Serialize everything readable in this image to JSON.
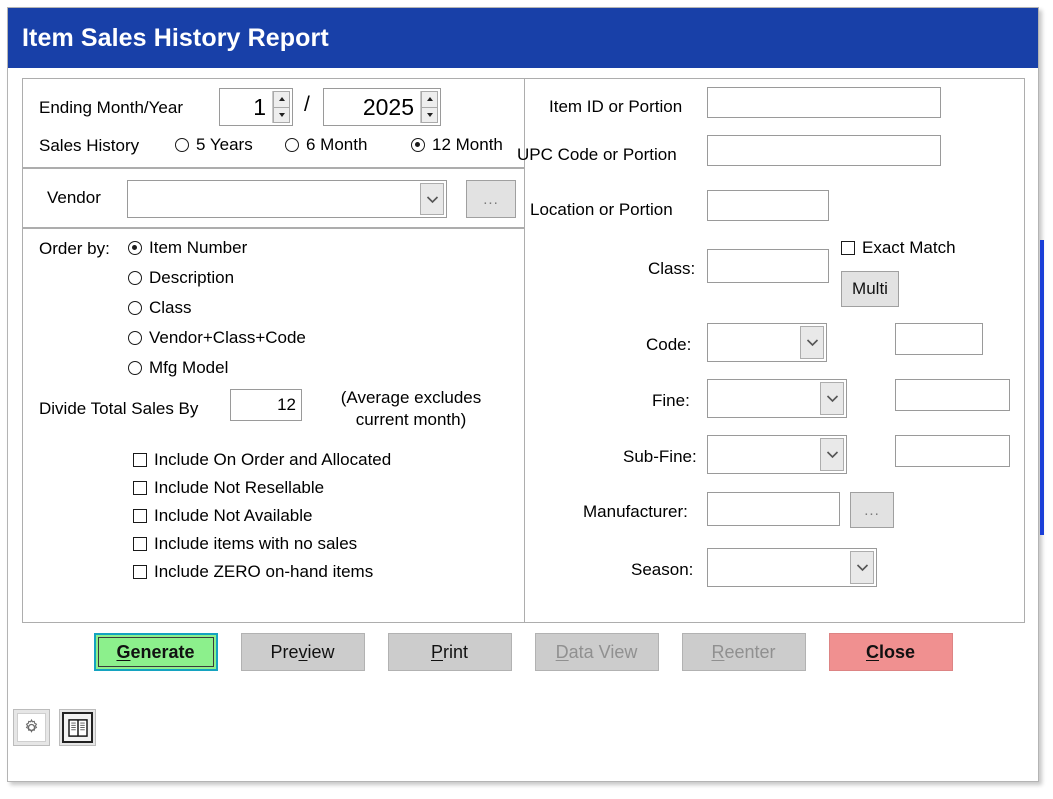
{
  "window": {
    "title": "Item Sales History Report"
  },
  "period": {
    "ending_label": "Ending Month/Year",
    "month_value": "1",
    "separator": "/",
    "year_value": "2025",
    "sales_history_label": "Sales History",
    "history_options": [
      {
        "label": "5 Years",
        "selected": false
      },
      {
        "label": "6 Month",
        "selected": false
      },
      {
        "label": "12 Month",
        "selected": true
      }
    ]
  },
  "vendor": {
    "label": "Vendor",
    "value": "",
    "lookup_button": "..."
  },
  "order_by": {
    "label": "Order by:",
    "options": [
      {
        "label": "Item Number",
        "selected": true
      },
      {
        "label": "Description",
        "selected": false
      },
      {
        "label": "Class",
        "selected": false
      },
      {
        "label": "Vendor+Class+Code",
        "selected": false
      },
      {
        "label": "Mfg Model",
        "selected": false
      }
    ],
    "divide_label": "Divide Total Sales By",
    "divide_value": "12",
    "note_line1": "(Average excludes",
    "note_line2": "current month)",
    "checkboxes": [
      {
        "label": "Include On Order and Allocated",
        "checked": false
      },
      {
        "label": "Include Not Resellable",
        "checked": false
      },
      {
        "label": "Include Not Available",
        "checked": false
      },
      {
        "label": "Include items with no sales",
        "checked": false
      },
      {
        "label": "Include ZERO on-hand items",
        "checked": false
      }
    ]
  },
  "filters": {
    "item_id_label": "Item ID or Portion",
    "item_id_value": "",
    "upc_label": "UPC Code or Portion",
    "upc_value": "",
    "location_label": "Location or Portion",
    "location_value": "",
    "exact_match_label": "Exact Match",
    "exact_match_checked": false,
    "class_label": "Class:",
    "class_value": "",
    "multi_button": "Multi",
    "code_label": "Code:",
    "code_value": "",
    "code_extra_value": "",
    "fine_label": "Fine:",
    "fine_value": "",
    "fine_extra_value": "",
    "subfine_label": "Sub-Fine:",
    "subfine_value": "",
    "subfine_extra_value": "",
    "manufacturer_label": "Manufacturer:",
    "manufacturer_value": "",
    "manufacturer_lookup": "...",
    "season_label": "Season:",
    "season_value": ""
  },
  "buttons": [
    {
      "label": "Generate",
      "accel": "G",
      "state": "primary"
    },
    {
      "label": "Preview",
      "accel": "v",
      "state": "normal"
    },
    {
      "label": "Print",
      "accel": "P",
      "state": "normal"
    },
    {
      "label": "Data View",
      "accel": "D",
      "state": "disabled"
    },
    {
      "label": "Reenter",
      "accel": "R",
      "state": "disabled"
    },
    {
      "label": "Close",
      "accel": "C",
      "state": "danger"
    }
  ],
  "tools": [
    {
      "name": "gear-icon",
      "title": "Settings"
    },
    {
      "name": "book-icon",
      "title": "Manual"
    }
  ],
  "colors": {
    "title_bar": "#1840a8",
    "primary_button": "#8cf08c",
    "primary_border": "#14a3c0",
    "danger_button": "#f09090",
    "scroll_thumb": "#1b3fd8"
  }
}
